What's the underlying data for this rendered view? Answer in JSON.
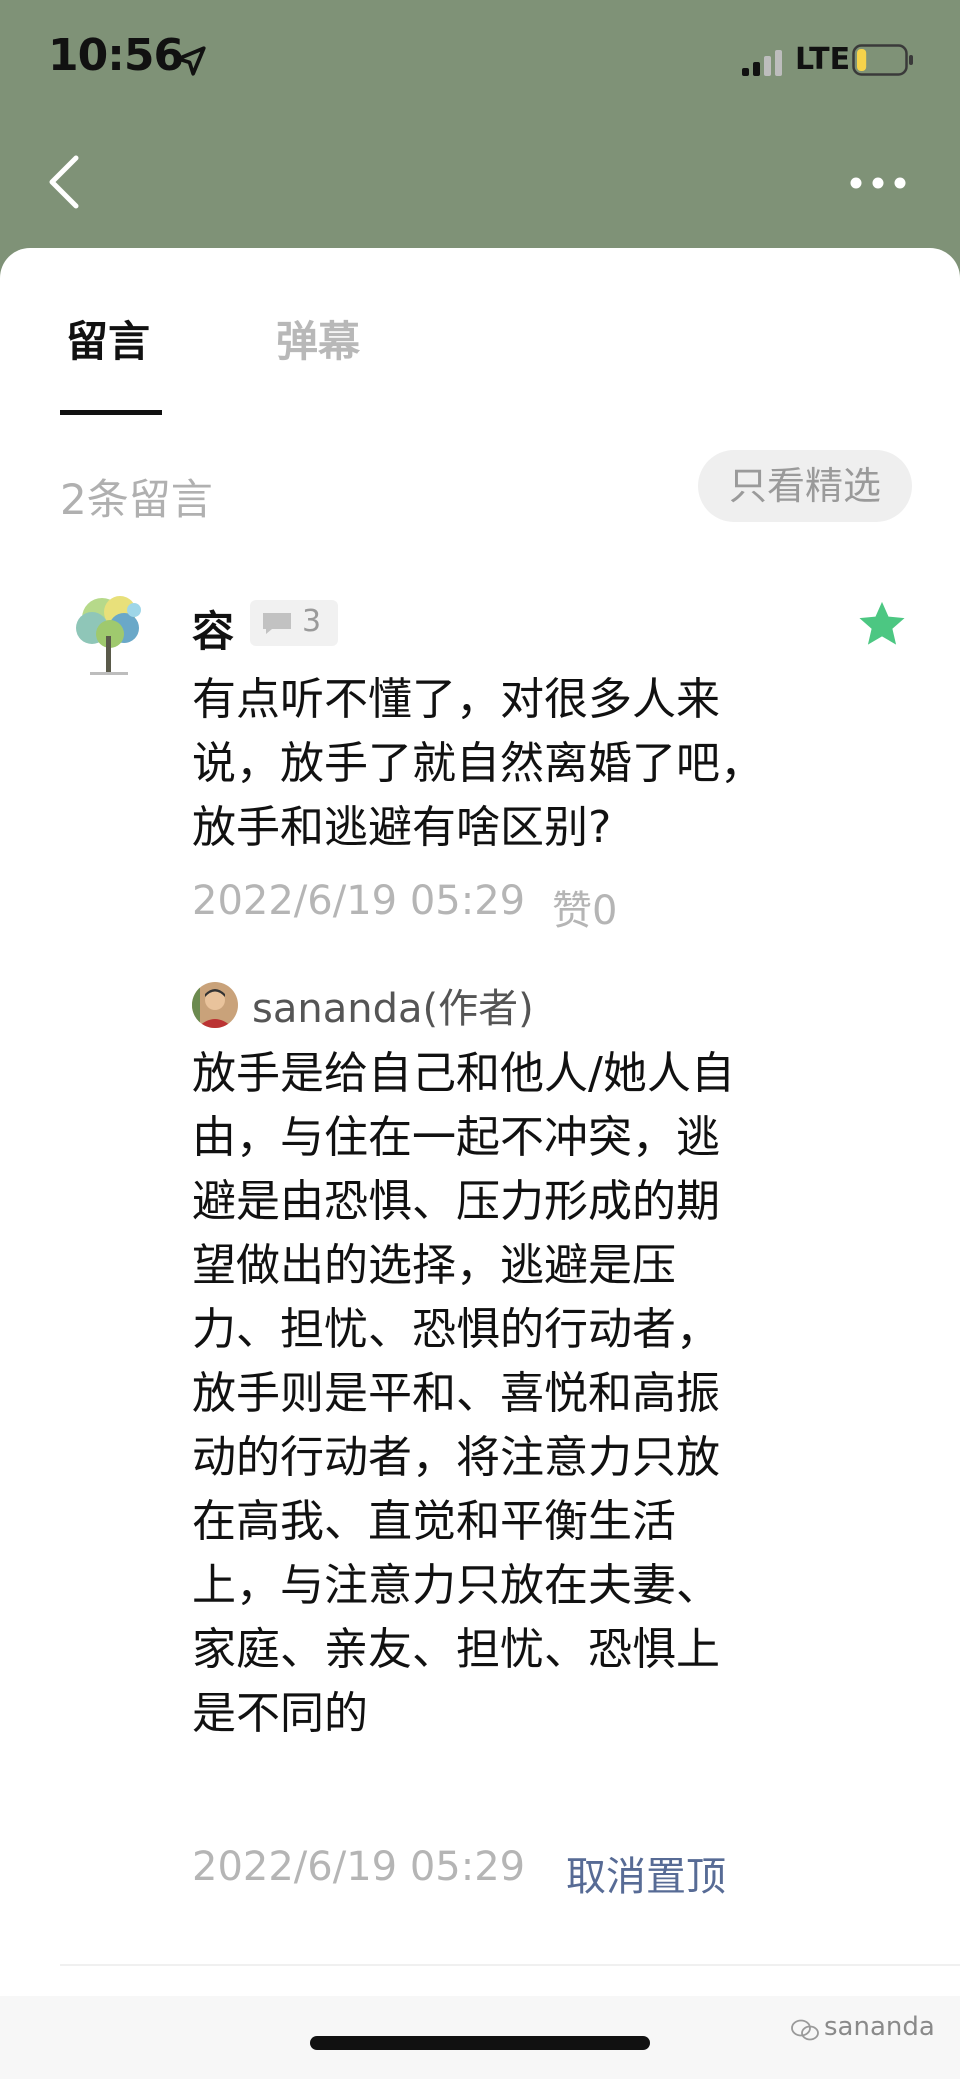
{
  "status_bar": {
    "time": "10:56",
    "network": "LTE",
    "battery_level": 0.2,
    "icons": [
      "location-arrow-icon",
      "signal-icon",
      "battery-icon"
    ]
  },
  "nav": {
    "icons": [
      "back-icon",
      "more-icon"
    ]
  },
  "tabs": [
    {
      "label": "留言",
      "active": true
    },
    {
      "label": "弹幕",
      "active": false
    }
  ],
  "comments_header": {
    "count_label": "2条留言",
    "filter_label": "只看精选"
  },
  "comment": {
    "user_name": "容",
    "reply_count": "3",
    "text": "有点听不懂了，对很多人来说，放手了就自然离婚了吧，放手和逃避有啥区别?",
    "time": "2022/6/19 05:29",
    "likes": "赞0",
    "featured": true,
    "accent_color": "#4cc782"
  },
  "author_reply": {
    "author_name": "sananda(作者)",
    "text": "放手是给自己和他人/她人自由，与住在一起不冲突，逃避是由恐惧、压力形成的期望做出的选择，逃避是压力、担忧、恐惧的行动者，放手则是平和、喜悦和高振动的行动者，将注意力只放在高我、直觉和平衡生活上，与注意力只放在夫妻、家庭、亲友、担忧、恐惧上是不同的",
    "time": "2022/6/19 05:29",
    "action_label": "取消置顶",
    "action_color": "#576b95"
  },
  "watermark": {
    "text": "sananda"
  }
}
